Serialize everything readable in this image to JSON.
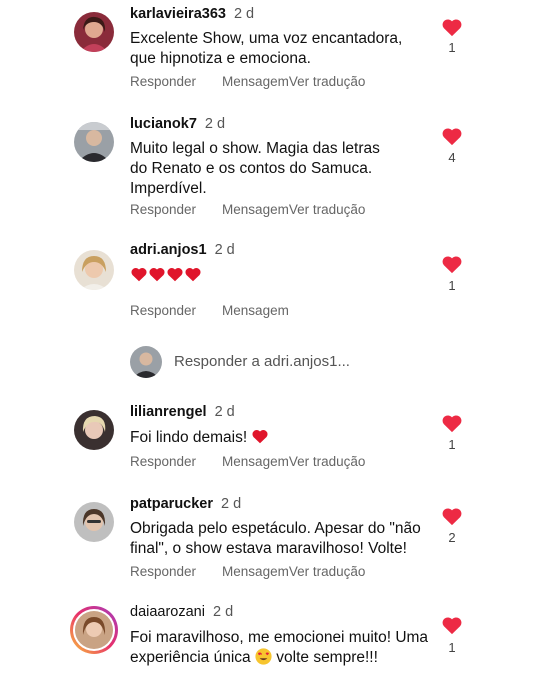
{
  "comments": [
    {
      "username": "karlavieira363",
      "time": "2 d",
      "text": "Excelente Show, uma voz encantadora, que hipnotiza e emociona.",
      "likes": "1",
      "reply": "Responder",
      "message": "Mensagem",
      "translate": "Ver tradução"
    },
    {
      "username": "lucianok7",
      "time": "2 d",
      "text": "Muito legal o show. Magia das letras do Renato e os contos do Samuca. Imperdível.",
      "likes": "4",
      "reply": "Responder",
      "message": "Mensagem",
      "translate": "Ver tradução"
    },
    {
      "username": "adri.anjos1",
      "time": "2 d",
      "text": "",
      "likes": "1",
      "reply": "Responder",
      "message": "Mensagem"
    },
    {
      "username": "lilianrengel",
      "time": "2 d",
      "text": "Foi lindo demais!",
      "likes": "1",
      "reply": "Responder",
      "message": "Mensagem",
      "translate": "Ver tradução"
    },
    {
      "username": "patparucker",
      "time": "2 d",
      "text": "Obrigada pelo espetáculo. Apesar do \"não final\", o show estava maravilhoso! Volte!",
      "likes": "2",
      "reply": "Responder",
      "message": "Mensagem",
      "translate": "Ver tradução"
    },
    {
      "username": "daiaarozani",
      "time": "2 d",
      "text_a": "Foi maravilhoso, me emocionei muito! Uma experiência única",
      "text_b": "volte sempre!!!",
      "likes": "1"
    }
  ],
  "reply_prompt": "Responder a adri.anjos1...",
  "icons": {
    "like": "heart-icon",
    "emoji_heart": "red-heart-emoji",
    "emoji_smile": "heart-eyes-emoji"
  },
  "colors": {
    "heart": "#ed2a44",
    "secondary_text": "#666666"
  }
}
